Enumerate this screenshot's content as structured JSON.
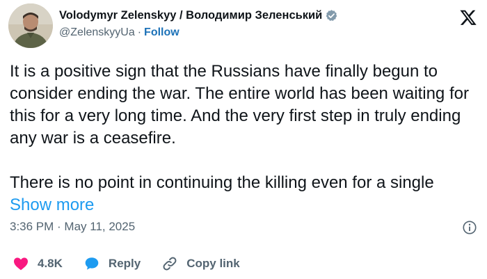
{
  "author": {
    "display_name": "Volodymyr Zelenskyy / Володимир Зеленський",
    "handle": "@ZelenskyyUa",
    "separator": "·",
    "follow_label": "Follow",
    "verified_icon": "verified-badge-icon",
    "avatar_icon": "profile-avatar"
  },
  "brand": {
    "logo_icon": "x-logo-icon"
  },
  "tweet": {
    "paragraph_1": "It is a positive sign that the Russians have finally begun to consider ending the war. The entire world has been waiting for this for a very long time. And the very first step in truly ending any war is a ceasefire.",
    "paragraph_2": "There is no point in continuing the killing even for a single",
    "show_more_label": "Show more"
  },
  "meta": {
    "timestamp": "3:36 PM · May 11, 2025",
    "info_icon": "info-icon"
  },
  "actions": {
    "like_count": "4.8K",
    "reply_label": "Reply",
    "copy_link_label": "Copy link",
    "like_icon": "heart-icon",
    "reply_icon": "speech-bubble-icon",
    "copy_icon": "link-icon"
  },
  "colors": {
    "text": "#0f1419",
    "secondary": "#536471",
    "link": "#1d9bf0",
    "like": "#f91880",
    "verified": "#829aab"
  }
}
